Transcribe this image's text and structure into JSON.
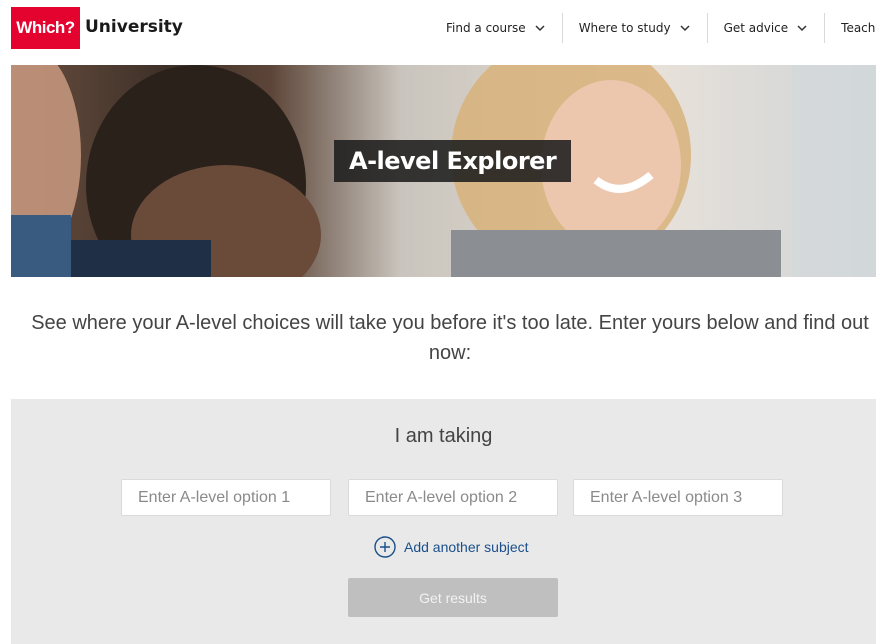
{
  "header": {
    "logo_brand": "Which?",
    "logo_product": "University",
    "nav": [
      {
        "label": "Find a course"
      },
      {
        "label": "Where to study"
      },
      {
        "label": "Get advice"
      },
      {
        "label": "Teachers"
      }
    ]
  },
  "hero": {
    "title": "A-level Explorer"
  },
  "intro": {
    "text": "See where your A-level choices will take you before it's too late. Enter yours below and find out now:"
  },
  "form": {
    "heading": "I am taking",
    "fields": [
      {
        "placeholder": "Enter A-level option 1",
        "value": ""
      },
      {
        "placeholder": "Enter A-level option 2",
        "value": ""
      },
      {
        "placeholder": "Enter A-level option 3",
        "value": ""
      }
    ],
    "add_subject_label": "Add another subject",
    "submit_label": "Get results"
  },
  "colors": {
    "brand_red": "#e4032e",
    "link_blue": "#1a4f8b",
    "form_bg": "#e9e9e9",
    "button_disabled": "#bfbfbf"
  },
  "icons": [
    "chevron-down-icon",
    "plus-circle-icon"
  ]
}
